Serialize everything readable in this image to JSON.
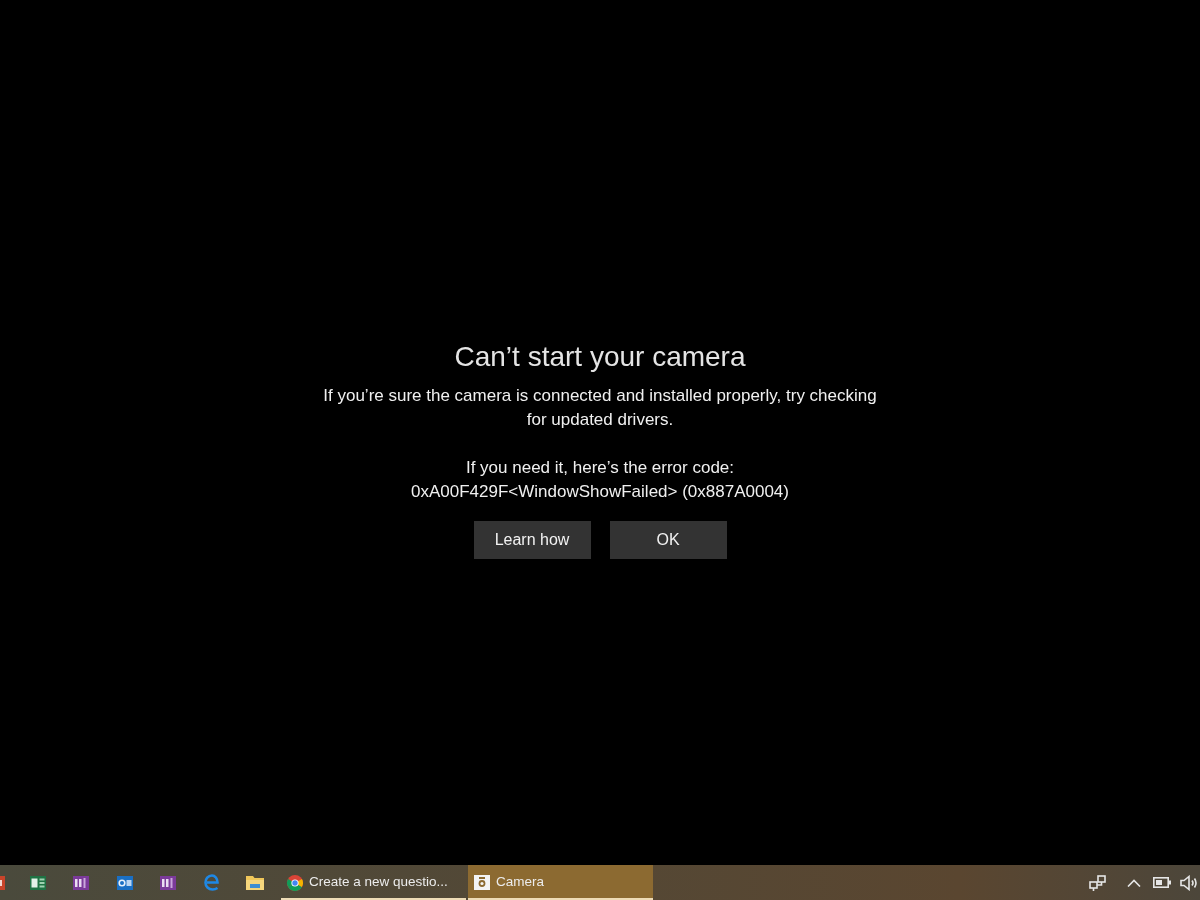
{
  "dialog": {
    "title": "Can’t start your camera",
    "message": "If you’re sure the camera is connected and installed properly, try checking for updated drivers.",
    "error_intro": "If you need it, here’s the error code:",
    "error_code": "0xA00F429F<WindowShowFailed> (0x887A0004)",
    "buttons": [
      "Learn how",
      "OK"
    ]
  },
  "taskbar": {
    "items": [
      {
        "kind": "pinned",
        "open": false,
        "selected": false
      },
      {
        "kind": "pinned",
        "open": false,
        "selected": false
      },
      {
        "kind": "pinned",
        "open": false,
        "selected": false
      },
      {
        "kind": "pinned",
        "open": false,
        "selected": false
      },
      {
        "kind": "pinned",
        "open": false,
        "selected": false
      },
      {
        "kind": "pinned",
        "open": false,
        "selected": false
      },
      {
        "kind": "pinned",
        "open": false,
        "selected": false
      },
      {
        "kind": "window",
        "label": "Create a new questio...",
        "open": true,
        "selected": false
      },
      {
        "kind": "window",
        "label": "Camera",
        "open": true,
        "selected": true
      }
    ]
  }
}
